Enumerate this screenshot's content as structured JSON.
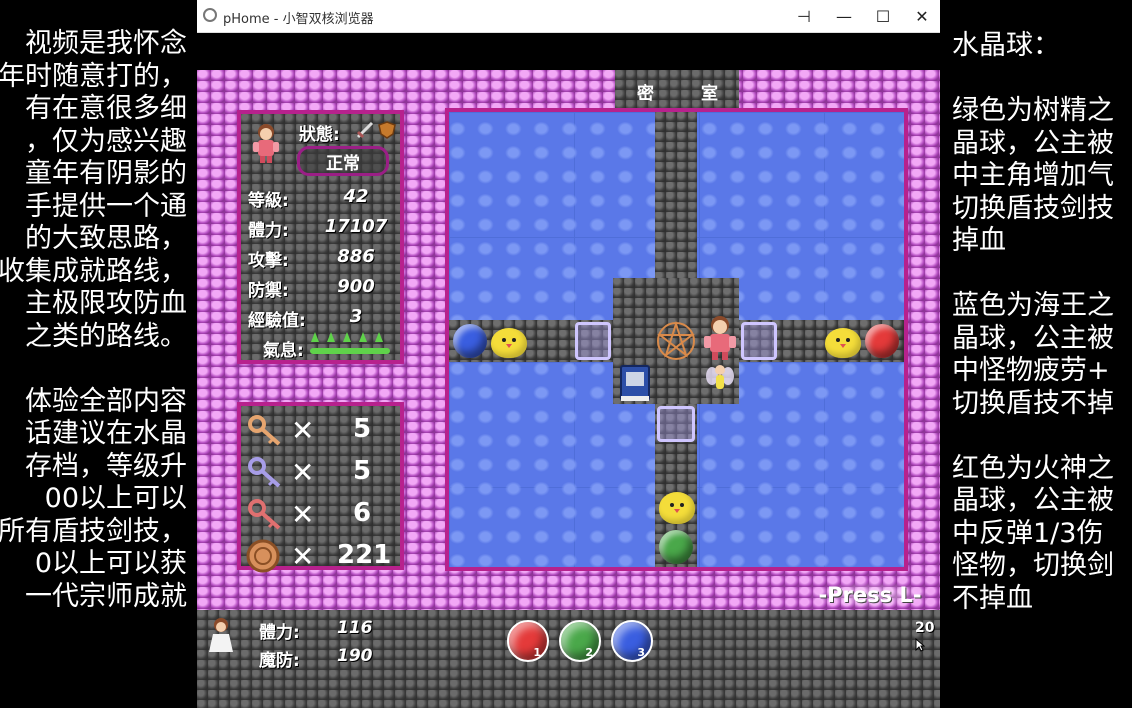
{
  "left_caption": [
    "视频是我怀念",
    "年时随意打的，",
    "有在意很多细",
    "，仅为感兴趣",
    "童年有阴影的",
    "手提供一个通",
    "的大致思路，",
    "收集成就路线，",
    "主极限攻防血",
    "之类的路线。",
    "",
    "体验全部内容",
    "话建议在水晶",
    "存档，等级升",
    "00以上可以",
    "所有盾技剑技，",
    "0以上可以获",
    "一代宗师成就"
  ],
  "right_caption": [
    "水晶球：",
    "",
    "绿色为树精之",
    "晶球，公主被",
    "中主角增加气",
    "切换盾技剑技",
    "掉血",
    "",
    "蓝色为海王之",
    "晶球，公主被",
    "中怪物疲劳+",
    "切换盾技不掉",
    "",
    "红色为火神之",
    "晶球，公主被",
    "中反弹1/3伤",
    "怪物，切换剑",
    "不掉血"
  ],
  "window": {
    "title": "pHome - 小智双核浏览器",
    "pin_glyph": "⊣",
    "min_glyph": "—",
    "max_glyph": "☐",
    "close_glyph": "✕"
  },
  "room": {
    "name_left": "密",
    "name_right": "室"
  },
  "status": {
    "label": "狀態:",
    "value": "正常",
    "rows": [
      {
        "label": "等級:",
        "value": "42"
      },
      {
        "label": "體力:",
        "value": "17107"
      },
      {
        "label": "攻擊:",
        "value": "886"
      },
      {
        "label": "防禦:",
        "value": "900"
      },
      {
        "label": "經驗值:",
        "value": "3"
      }
    ],
    "qi_label": "氣息:"
  },
  "keys": {
    "multiply": "✕",
    "items": [
      {
        "icon": "yellow-key-icon",
        "color": "#e6a56f",
        "count": "5"
      },
      {
        "icon": "blue-key-icon",
        "color": "#a79de8",
        "count": "5"
      },
      {
        "icon": "red-key-icon",
        "color": "#e07070",
        "count": "6"
      },
      {
        "icon": "gold-coin-icon",
        "color": "#d7905c",
        "count": "221"
      }
    ]
  },
  "press_hint": "-Press L-",
  "companion": {
    "hp_label": "體力:",
    "hp_value": "116",
    "mdef_label": "魔防:",
    "mdef_value": "190"
  },
  "skills": [
    {
      "icon": "red-skill-orb-icon",
      "color": "#e43a3a",
      "num": "1"
    },
    {
      "icon": "green-skill-orb-icon",
      "color": "#4aa84a",
      "num": "2"
    },
    {
      "icon": "blue-skill-orb-icon",
      "color": "#3a5ee0",
      "num": "3"
    }
  ],
  "floor_number": "20",
  "colors": {
    "frame": "#b7218d",
    "water": "#5a78e8",
    "stone": "#4a4a4a",
    "wall": "#c85ad2"
  }
}
